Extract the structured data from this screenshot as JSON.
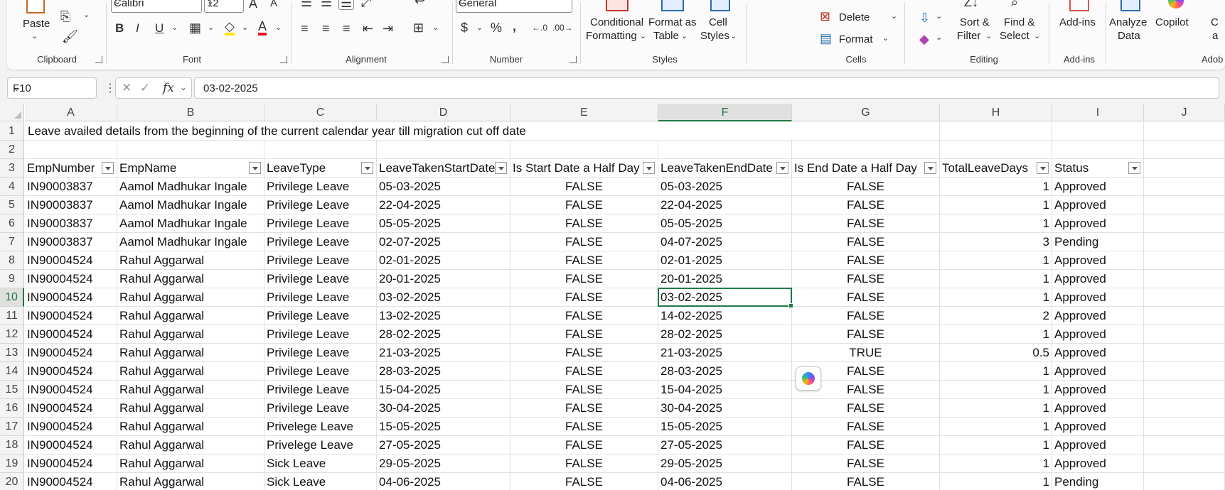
{
  "ribbon": {
    "groups": {
      "clipboard": "Clipboard",
      "font": "Font",
      "alignment": "Alignment",
      "number": "Number",
      "styles": "Styles",
      "cells": "Cells",
      "editing": "Editing",
      "addins": "Add-ins",
      "adobe": "Adob"
    },
    "paste": "Paste",
    "font_name": "Calibri",
    "font_size": "12",
    "number_format": "General",
    "conditional_formatting": [
      "Conditional",
      "Formatting"
    ],
    "format_as_table": [
      "Format as",
      "Table"
    ],
    "cell_styles": [
      "Cell",
      "Styles"
    ],
    "delete": "Delete",
    "format": "Format",
    "sort_filter": [
      "Sort &",
      "Filter"
    ],
    "find_select": [
      "Find &",
      "Select"
    ],
    "addins": "Add-ins",
    "analyze_data": [
      "Analyze",
      "Data"
    ],
    "copilot": "Copilot",
    "cut_off": [
      "C",
      "a"
    ]
  },
  "formula_bar": {
    "name_box": "F10",
    "formula": "03-02-2025",
    "fx": "fx"
  },
  "grid": {
    "columns": [
      "A",
      "B",
      "C",
      "D",
      "E",
      "F",
      "G",
      "H",
      "I",
      "J"
    ],
    "row_numbers": [
      "1",
      "1",
      "2",
      "3",
      "4",
      "5",
      "6",
      "7",
      "8",
      "9",
      "10",
      "11",
      "12",
      "13",
      "14",
      "15",
      "16",
      "17",
      "18",
      "19",
      "20"
    ],
    "title": "Leave availed details from the beginning of the current calendar year till migration cut off date",
    "headers": [
      "EmpNumber",
      "EmpName",
      "LeaveType",
      "LeaveTakenStartDate",
      "Is Start Date a Half Day",
      "LeaveTakenEndDate",
      "Is End Date a Half Day",
      "TotalLeaveDays",
      "Status"
    ],
    "rows": [
      [
        "IN90003837",
        "Aamol Madhukar Ingale",
        "Privilege Leave",
        "05-03-2025",
        "FALSE",
        "05-03-2025",
        "FALSE",
        "1",
        "Approved"
      ],
      [
        "IN90003837",
        "Aamol Madhukar Ingale",
        "Privilege Leave",
        "22-04-2025",
        "FALSE",
        "22-04-2025",
        "FALSE",
        "1",
        "Approved"
      ],
      [
        "IN90003837",
        "Aamol Madhukar Ingale",
        "Privilege Leave",
        "05-05-2025",
        "FALSE",
        "05-05-2025",
        "FALSE",
        "1",
        "Approved"
      ],
      [
        "IN90003837",
        "Aamol Madhukar Ingale",
        "Privilege Leave",
        "02-07-2025",
        "FALSE",
        "04-07-2025",
        "FALSE",
        "3",
        "Pending"
      ],
      [
        "IN90004524",
        "Rahul  Aggarwal",
        "Privilege Leave",
        "02-01-2025",
        "FALSE",
        "02-01-2025",
        "FALSE",
        "1",
        "Approved"
      ],
      [
        "IN90004524",
        "Rahul  Aggarwal",
        "Privilege Leave",
        "20-01-2025",
        "FALSE",
        "20-01-2025",
        "FALSE",
        "1",
        "Approved"
      ],
      [
        "IN90004524",
        "Rahul  Aggarwal",
        "Privilege Leave",
        "03-02-2025",
        "FALSE",
        "03-02-2025",
        "FALSE",
        "1",
        "Approved"
      ],
      [
        "IN90004524",
        "Rahul  Aggarwal",
        "Privilege Leave",
        "13-02-2025",
        "FALSE",
        "14-02-2025",
        "FALSE",
        "2",
        "Approved"
      ],
      [
        "IN90004524",
        "Rahul  Aggarwal",
        "Privilege Leave",
        "28-02-2025",
        "FALSE",
        "28-02-2025",
        "FALSE",
        "1",
        "Approved"
      ],
      [
        "IN90004524",
        "Rahul  Aggarwal",
        "Privilege Leave",
        "21-03-2025",
        "FALSE",
        "21-03-2025",
        "TRUE",
        "0.5",
        "Approved"
      ],
      [
        "IN90004524",
        "Rahul  Aggarwal",
        "Privilege Leave",
        "28-03-2025",
        "FALSE",
        "28-03-2025",
        "FALSE",
        "1",
        "Approved"
      ],
      [
        "IN90004524",
        "Rahul  Aggarwal",
        "Privilege Leave",
        "15-04-2025",
        "FALSE",
        "15-04-2025",
        "FALSE",
        "1",
        "Approved"
      ],
      [
        "IN90004524",
        "Rahul  Aggarwal",
        "Privilege Leave",
        "30-04-2025",
        "FALSE",
        "30-04-2025",
        "FALSE",
        "1",
        "Approved"
      ],
      [
        "IN90004524",
        "Rahul  Aggarwal",
        "Privelege Leave",
        "15-05-2025",
        "FALSE",
        "15-05-2025",
        "FALSE",
        "1",
        "Approved"
      ],
      [
        "IN90004524",
        "Rahul  Aggarwal",
        "Privelege Leave",
        "27-05-2025",
        "FALSE",
        "27-05-2025",
        "FALSE",
        "1",
        "Approved"
      ],
      [
        "IN90004524",
        "Rahul  Aggarwal",
        "Sick Leave",
        "29-05-2025",
        "FALSE",
        "29-05-2025",
        "FALSE",
        "1",
        "Approved"
      ],
      [
        "IN90004524",
        "Rahul  Aggarwal",
        "Sick Leave",
        "04-06-2025",
        "FALSE",
        "04-06-2025",
        "FALSE",
        "1",
        "Pending"
      ]
    ]
  },
  "colors": {
    "selection": "#1f7a43",
    "fill_highlight": "#ffe600",
    "font_color": "#e81123"
  }
}
